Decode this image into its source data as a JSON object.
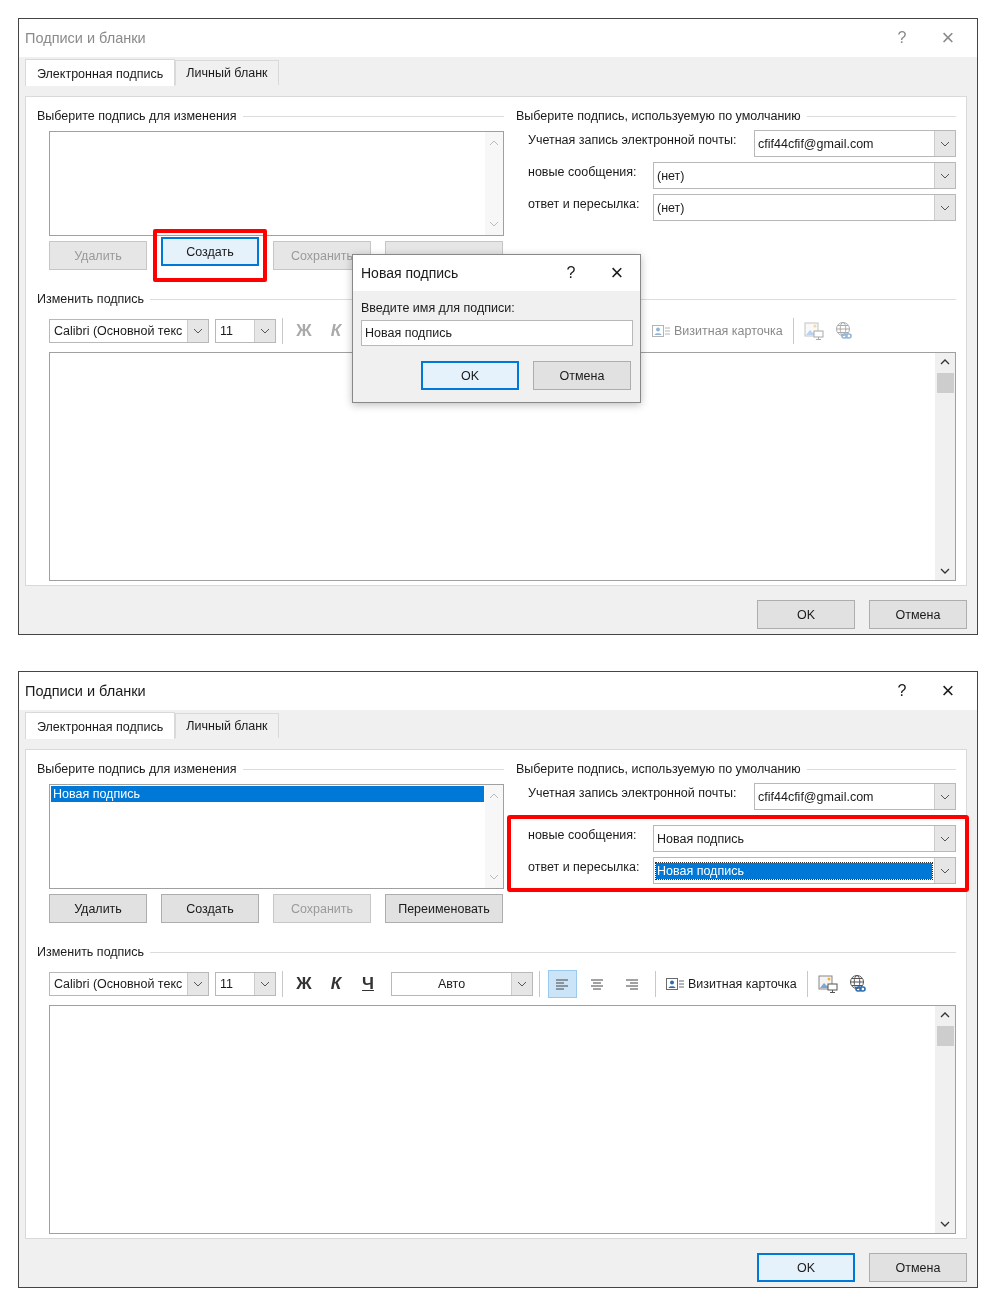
{
  "dialogs": [
    {
      "title": "Подписи и бланки",
      "active": false,
      "help": "?",
      "close": "×",
      "tabs": [
        {
          "label": "Электронная подпись",
          "selected": true
        },
        {
          "label": "Личный бланк",
          "selected": false
        }
      ],
      "edit_heading": "Выберите подпись для изменения",
      "list_buttons": [
        {
          "label": "Удалить",
          "disabled": true,
          "focused": false,
          "highlighted": false
        },
        {
          "label": "Создать",
          "disabled": false,
          "focused": true,
          "highlighted": true
        },
        {
          "label": "Сохранить",
          "disabled": true,
          "focused": false,
          "highlighted": false
        },
        {
          "disabled": true,
          "focused": false,
          "highlighted": false
        }
      ],
      "defaults": {
        "heading": "Выберите подпись, используемую по умолчанию",
        "rows_highlighted": false,
        "account": {
          "label": "Учетная запись электронной почты:",
          "value": "cfif44cfif@gmail.com"
        },
        "rows": [
          {
            "label": "новые сообщения:",
            "value": "(нет)",
            "value_selected": false
          },
          {
            "label": "ответ и пересылка:",
            "value": "(нет)",
            "value_selected": false
          }
        ]
      },
      "change_heading": "Изменить подпись",
      "toolbar": [
        {
          "kind": "font",
          "value": "Calibri (Основной текс"
        },
        {
          "kind": "size",
          "value": "11"
        },
        {
          "kind": "separator"
        },
        {
          "kind": "bold",
          "label": "Ж",
          "disabled": true
        },
        {
          "kind": "italic",
          "label": "К",
          "disabled": true
        },
        {
          "kind": "card",
          "label": "Визитная карточка",
          "disabled": true
        },
        {
          "kind": "separator"
        },
        {
          "kind": "picture",
          "disabled": true
        },
        {
          "kind": "link",
          "disabled": true
        }
      ],
      "footer": [
        {
          "label": "OK",
          "focused": false
        },
        {
          "label": "Отмена",
          "focused": false
        }
      ],
      "popup": {
        "title": "Новая подпись",
        "help": "?",
        "close": "×",
        "prompt": "Введите имя для подписи:",
        "value": "Новая подпись",
        "buttons": [
          {
            "label": "OK",
            "focused": true
          },
          {
            "label": "Отмена",
            "focused": false
          }
        ]
      }
    },
    {
      "title": "Подписи и бланки",
      "active": true,
      "help": "?",
      "close": "×",
      "tabs": [
        {
          "label": "Электронная подпись",
          "selected": true
        },
        {
          "label": "Личный бланк",
          "selected": false
        }
      ],
      "edit_heading": "Выберите подпись для изменения",
      "signatures": [
        {
          "label": "Новая подпись",
          "selected": true
        }
      ],
      "list_buttons": [
        {
          "label": "Удалить",
          "disabled": false,
          "focused": false,
          "highlighted": false
        },
        {
          "label": "Создать",
          "disabled": false,
          "focused": false,
          "highlighted": false
        },
        {
          "label": "Сохранить",
          "disabled": true,
          "focused": false,
          "highlighted": false
        },
        {
          "label": "Переименовать",
          "disabled": false,
          "focused": false,
          "highlighted": false
        }
      ],
      "defaults": {
        "heading": "Выберите подпись, используемую по умолчанию",
        "rows_highlighted": true,
        "account": {
          "label": "Учетная запись электронной почты:",
          "value": "cfif44cfif@gmail.com"
        },
        "rows": [
          {
            "label": "новые сообщения:",
            "value": "Новая подпись",
            "value_selected": false
          },
          {
            "label": "ответ и пересылка:",
            "value": "Новая подпись",
            "value_selected": true
          }
        ]
      },
      "change_heading": "Изменить подпись",
      "toolbar": [
        {
          "kind": "font",
          "value": "Calibri (Основной текс"
        },
        {
          "kind": "size",
          "value": "11"
        },
        {
          "kind": "separator"
        },
        {
          "kind": "bold",
          "label": "Ж",
          "disabled": false
        },
        {
          "kind": "italic",
          "label": "К",
          "disabled": false
        },
        {
          "kind": "underline",
          "label": "Ч",
          "disabled": false
        },
        {
          "kind": "color",
          "value": "Авто"
        },
        {
          "kind": "separator"
        },
        {
          "kind": "align_left",
          "selected": true
        },
        {
          "kind": "align_center",
          "selected": false
        },
        {
          "kind": "align_right",
          "selected": false
        },
        {
          "kind": "separator"
        },
        {
          "kind": "card",
          "label": "Визитная карточка",
          "disabled": false
        },
        {
          "kind": "separator"
        },
        {
          "kind": "picture",
          "disabled": false
        },
        {
          "kind": "link",
          "disabled": false
        }
      ],
      "footer": [
        {
          "label": "OK",
          "focused": true
        },
        {
          "label": "Отмена",
          "focused": false
        }
      ]
    }
  ]
}
